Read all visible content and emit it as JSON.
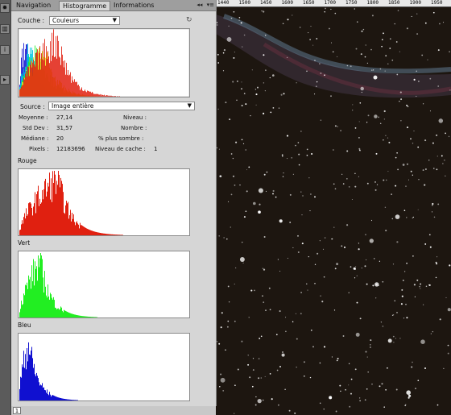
{
  "tabs": [
    {
      "label": "Navigation"
    },
    {
      "label": "Histogramme"
    },
    {
      "label": "Informations"
    }
  ],
  "panel_icons": [
    "collapse-icon",
    "menu-icon"
  ],
  "channel_label": "Couche :",
  "channel_value": "Couleurs",
  "source_label": "Source :",
  "source_value": "Image entière",
  "stats": {
    "moyenne_label": "Moyenne :",
    "moyenne_value": "27,14",
    "stddev_label": "Std Dev :",
    "stddev_value": "31,57",
    "mediane_label": "Médiane :",
    "mediane_value": "20",
    "pixels_label": "Pixels :",
    "pixels_value": "12183696",
    "niveau_label": "Niveau :",
    "nombre_label": "Nombre :",
    "pct_label": "% plus sombre :",
    "cache_label": "Niveau de cache :",
    "cache_value": "1"
  },
  "channels": [
    {
      "label": "Rouge",
      "color": "#e02010"
    },
    {
      "label": "Vert",
      "color": "#22ee22"
    },
    {
      "label": "Bleu",
      "color": "#1010d0"
    }
  ],
  "ruler_labels": [
    "1440",
    "1500",
    "1450",
    "1600",
    "1650",
    "1700",
    "1750",
    "1800",
    "1850",
    "1900",
    "1950"
  ],
  "status_text": "1"
}
